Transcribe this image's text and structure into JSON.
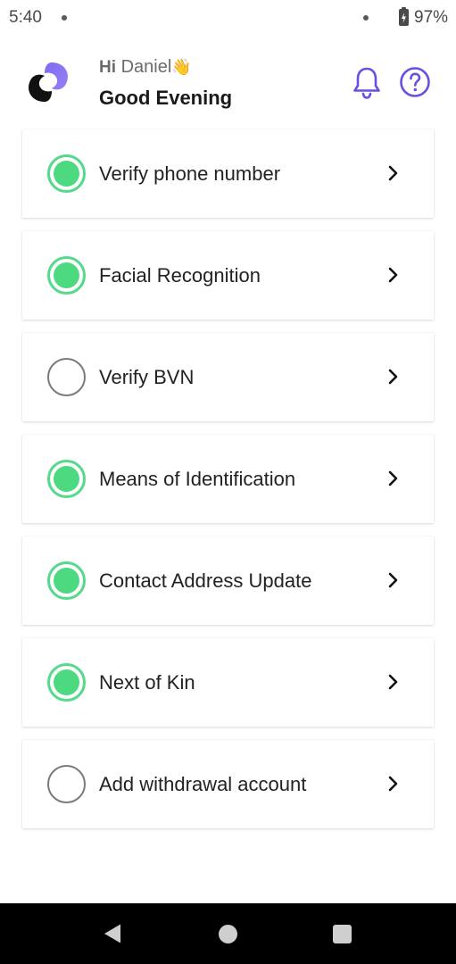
{
  "status_bar": {
    "time": "5:40",
    "battery": "97%"
  },
  "header": {
    "greeting_prefix": "Hi",
    "greeting_name": "Daniel",
    "greeting_emoji": "👋",
    "subtitle": "Good Evening",
    "icons": [
      "logo-icon",
      "bell-icon",
      "help-icon"
    ],
    "accent_color": "#6a4fe0"
  },
  "checklist": [
    {
      "label": "Verify phone number",
      "completed": true
    },
    {
      "label": "Facial Recognition",
      "completed": true
    },
    {
      "label": "Verify BVN",
      "completed": false
    },
    {
      "label": "Means of Identification",
      "completed": true
    },
    {
      "label": "Contact Address Update",
      "completed": true
    },
    {
      "label": "Next of Kin",
      "completed": true
    },
    {
      "label": "Add withdrawal account",
      "completed": false
    }
  ],
  "colors": {
    "complete": "#4dd97f",
    "incomplete": "#7a7a7a"
  },
  "nav": {
    "icons": [
      "back-icon",
      "home-icon",
      "recent-apps-icon"
    ]
  }
}
